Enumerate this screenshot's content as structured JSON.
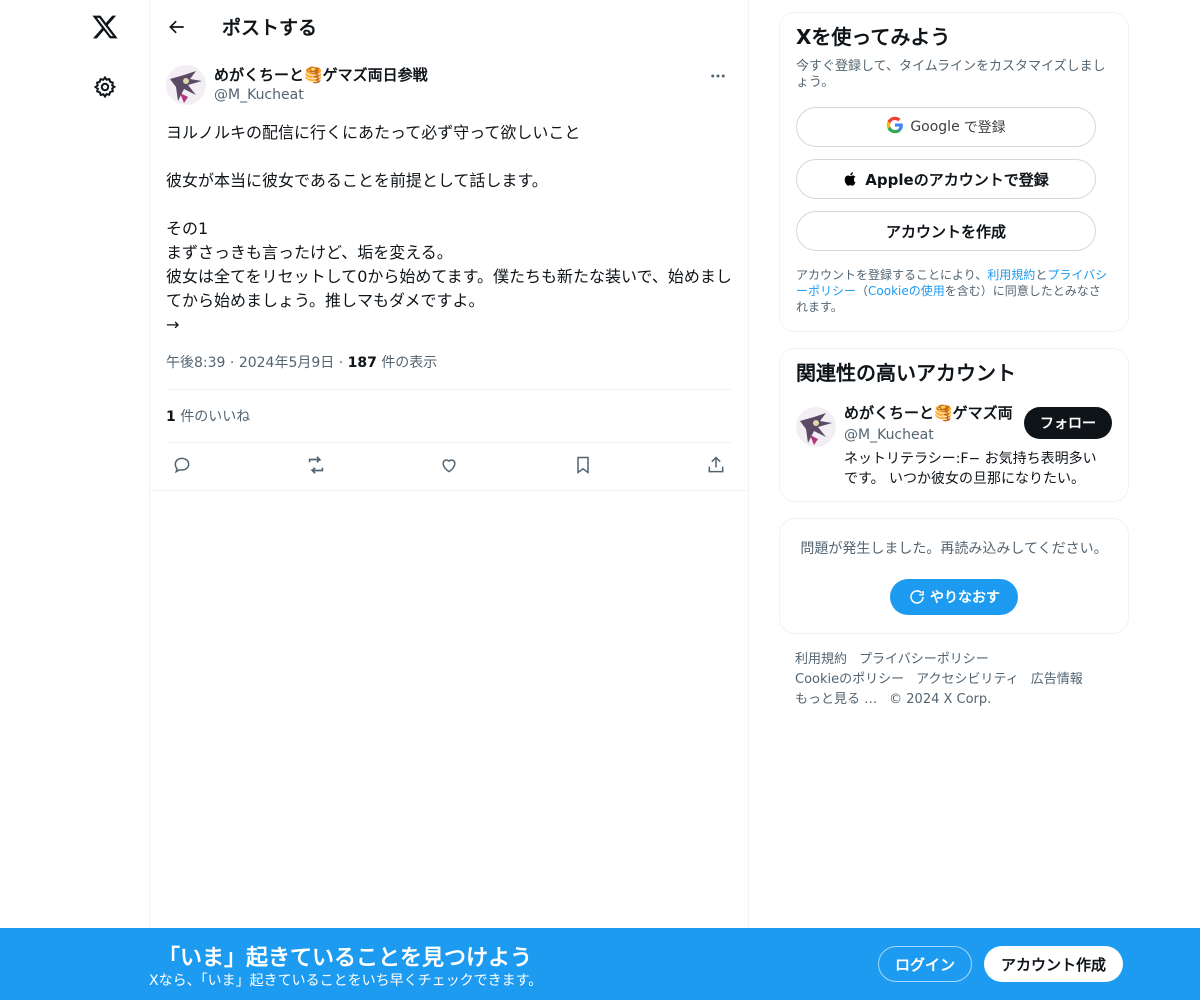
{
  "colors": {
    "accent": "#1d9bf0",
    "text": "#0f1419",
    "secondary": "#536471",
    "border": "#eff3f4"
  },
  "nav": {
    "logo_icon": "x-logo-icon",
    "settings_icon": "gear-icon"
  },
  "header": {
    "back_icon": "arrow-left-icon",
    "title": "ポストする"
  },
  "post": {
    "display_name": "めがくちーと🥞ゲマズ両日参戦",
    "handle": "@M_Kucheat",
    "more_label": "⋯",
    "text": "ヨルノルキの配信に行くにあたって必ず守って欲しいこと\n\n彼女が本当に彼女であることを前提として話します。\n\nその1\nまずさっきも言ったけど、垢を変える。\n彼女は全てをリセットして0から始めてます。僕たちも新たな装いで、始めましてから始めましょう。推しマもダメですよ。\n→",
    "time": "午後8:39",
    "date": "2024年5月9日",
    "views_count": "187",
    "views_label": "件の表示",
    "likes_count": "1",
    "likes_label": "件のいいね",
    "actions": [
      "reply-icon",
      "retweet-icon",
      "like-icon",
      "bookmark-icon",
      "share-icon"
    ]
  },
  "signup_card": {
    "title": "Xを使ってみよう",
    "subtitle": "今すぐ登録して、タイムラインをカスタマイズしましょう。",
    "google_brand": "Google",
    "google_label": "で登録",
    "apple_label": "Appleのアカウントで登録",
    "create_label": "アカウントを作成",
    "terms_prefix": "アカウントを登録することにより、",
    "terms_link": "利用規約",
    "terms_and": "と",
    "privacy_link": "プライバシーポリシー",
    "terms_mid": "（",
    "cookie_link": "Cookieの使用",
    "terms_suffix": "を含む）に同意したとみなされます。"
  },
  "related": {
    "title": "関連性の高いアカウント",
    "name": "めがくちーと🥞ゲマズ両日参戦",
    "handle": "@M_Kucheat",
    "follow_label": "フォロー",
    "bio": "ネットリテラシー:F− お気持ち表明多いです。 いつか彼女の旦那になりたい。"
  },
  "error": {
    "message": "問題が発生しました。再読み込みしてください。",
    "retry_label": "やりなおす"
  },
  "footer": {
    "terms": "利用規約",
    "privacy": "プライバシーポリシー",
    "cookie": "Cookieのポリシー",
    "accessibility": "アクセシビリティ",
    "ads": "広告情報",
    "more": "もっと見る …",
    "copyright": "© 2024 X Corp."
  },
  "bottom_bar": {
    "title": "「いま」起きていることを見つけよう",
    "subtitle": "Xなら、「いま」起きていることをいち早くチェックできます。",
    "login_label": "ログイン",
    "signup_label": "アカウント作成"
  }
}
